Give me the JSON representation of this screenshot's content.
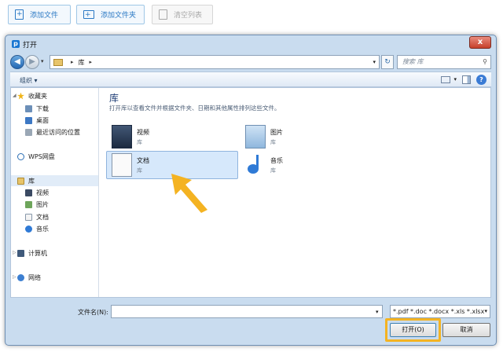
{
  "toolbar": {
    "add_file": "添加文件",
    "add_folder": "添加文件夹",
    "clear_list": "清空列表"
  },
  "dialog": {
    "logo": "p",
    "title": "打开",
    "close": "x"
  },
  "navigation": {
    "breadcrumb": "库",
    "search_placeholder": "搜索 库"
  },
  "commandbar": {
    "organize": "组织 ▾"
  },
  "navpane": {
    "favorites": "收藏夹",
    "favorites_items": [
      "下载",
      "桌面",
      "最近访问的位置"
    ],
    "wps": "WPS网盘",
    "libraries": "库",
    "library_items": [
      "视频",
      "图片",
      "文档",
      "音乐"
    ],
    "computer": "计算机",
    "network": "网络"
  },
  "content": {
    "heading": "库",
    "description": "打开库以查看文件并根据文件夹、日期和其他属性排列这些文件。",
    "tiles": [
      {
        "name": "视频",
        "sub": "库",
        "icon": "video-library-icon"
      },
      {
        "name": "图片",
        "sub": "库",
        "icon": "picture-library-icon"
      },
      {
        "name": "文档",
        "sub": "库",
        "icon": "document-library-icon",
        "selected": true
      },
      {
        "name": "音乐",
        "sub": "库",
        "icon": "music-library-icon"
      }
    ]
  },
  "bottom": {
    "filename_label": "文件名(N):",
    "filename_value": "",
    "filetype": "*.pdf *.doc *.docx *.xls *.xlsx",
    "open": "打开(O)",
    "cancel": "取消"
  },
  "colors": {
    "highlight_frame": "#f4b322",
    "arrow": "#f4b322",
    "selection": "#d6e8fb"
  }
}
